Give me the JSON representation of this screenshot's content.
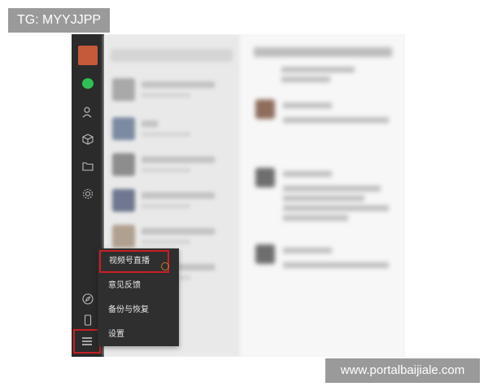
{
  "watermarks": {
    "top_left": "TG: MYYJJPP",
    "bottom_right": "www.portalbaijiale.com"
  },
  "sidebar": {
    "icons": [
      "chat-icon",
      "contacts-icon",
      "cube-icon",
      "folder-icon",
      "settings-gear-icon",
      "compass-icon",
      "phone-icon",
      "menu-icon"
    ]
  },
  "popup_menu": {
    "items": [
      {
        "label": "视频号直播"
      },
      {
        "label": "意见反馈"
      },
      {
        "label": "备份与恢复"
      },
      {
        "label": "设置"
      }
    ]
  },
  "colors": {
    "highlight_border": "#c91f25",
    "sidebar_bg": "#2b2b2b",
    "chat_icon_green": "#2fbf55"
  }
}
